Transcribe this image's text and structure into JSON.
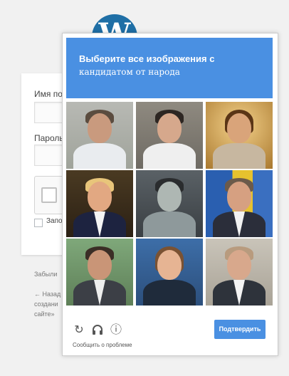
{
  "login": {
    "username_label": "Имя по",
    "password_label": "Пароль",
    "remember_label": "Запо",
    "lost_password": "Забыли",
    "back_link_1": "← Назад",
    "back_link_2": "создани",
    "back_link_3": "сайте»"
  },
  "challenge": {
    "title": "Выберите все изображения с",
    "subtitle": "кандидатом от народа",
    "tiles": [
      {
        "label": "man in white jacket"
      },
      {
        "label": "man with mustache"
      },
      {
        "label": "painted portrait"
      },
      {
        "label": "man with blond hair and eagle"
      },
      {
        "label": "man in grey tones"
      },
      {
        "label": "man in suit with flags"
      },
      {
        "label": "man with mustache in suit"
      },
      {
        "label": "woman with microphone"
      },
      {
        "label": "man with glass"
      }
    ],
    "footer": {
      "reload_icon": "↻",
      "audio_icon": "headphones",
      "info_icon": "ⓘ",
      "report_label": "Сообщить о проблеме",
      "verify_label": "Подтвердить"
    }
  },
  "colors": {
    "header": "#4a90e2",
    "button": "#4a90e2",
    "wordpress": "#1f6fa6"
  }
}
